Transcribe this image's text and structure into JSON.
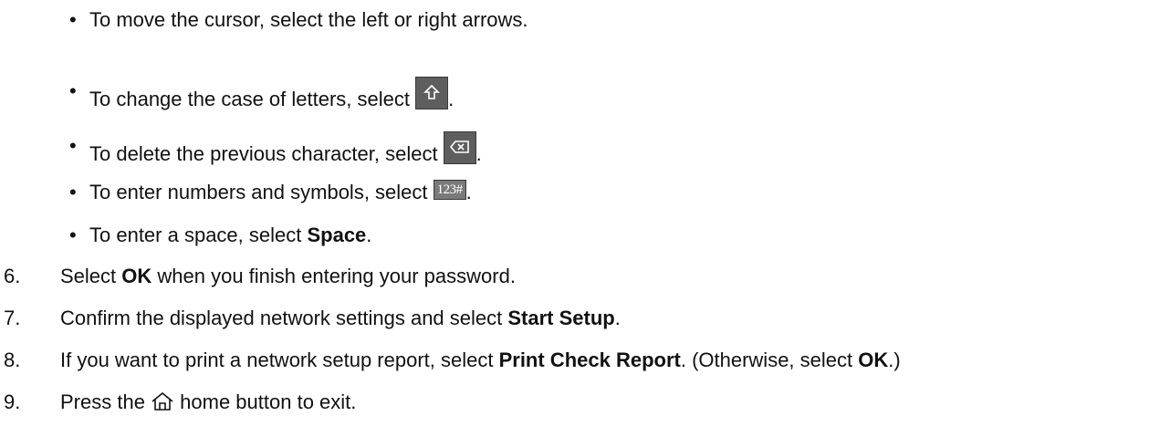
{
  "bullets": [
    {
      "text": "To move the cursor, select the left or right arrows."
    },
    {
      "before": "To change the case of letters, select ",
      "icon": "shift-key-icon",
      "after": "."
    },
    {
      "before": "To delete the previous character, select ",
      "icon": "backspace-key-icon",
      "after": "."
    },
    {
      "before": "To enter numbers and symbols, select ",
      "icon": "numbers-symbols-key-icon",
      "icon_label": "123#",
      "after": "."
    },
    {
      "before": "To enter a space, select ",
      "bold": "Space",
      "after": "."
    }
  ],
  "steps": [
    {
      "number": "6.",
      "before": "Select ",
      "bold": "OK",
      "after": " when you finish entering your password."
    },
    {
      "number": "7.",
      "before": "Confirm the displayed network settings and select ",
      "bold": "Start Setup",
      "after": "."
    },
    {
      "number": "8.",
      "before": "If you want to print a network setup report, select ",
      "bold": "Print Check Report",
      "middle": ". (Otherwise, select ",
      "bold2": "OK",
      "after": ".)"
    },
    {
      "number": "9.",
      "before": "Press the ",
      "icon": "home-icon",
      "after": " home button to exit."
    }
  ],
  "bullet_char": "•"
}
